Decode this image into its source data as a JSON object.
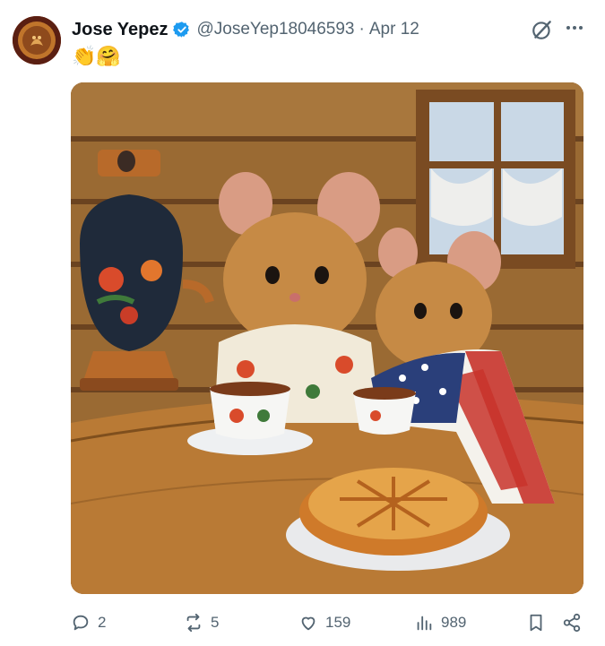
{
  "post": {
    "author_name": "Jose Yepez",
    "handle": "@JoseYep18046593",
    "separator": "·",
    "date": "Apr 12",
    "emoji_text": "👏🤗",
    "media": {
      "subject": "two mice drinking tea at a wooden table with a samovar and a pie"
    }
  },
  "actions": {
    "replies": "2",
    "reposts": "5",
    "likes": "159",
    "views": "989"
  },
  "icons": {
    "reply": "reply-icon",
    "repost": "repost-icon",
    "like": "heart-icon",
    "views": "views-icon",
    "bookmark": "bookmark-icon",
    "share": "share-icon",
    "grok": "grok-icon",
    "more": "more-icon",
    "verified": "verified-badge-icon"
  },
  "colors": {
    "verified": "#1d9bf0",
    "secondary_text": "#536471",
    "primary_text": "#0f1419"
  }
}
